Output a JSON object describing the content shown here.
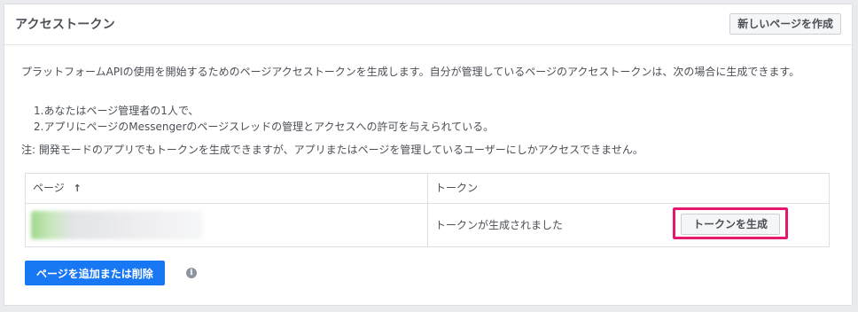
{
  "panel": {
    "title": "アクセストークン",
    "create_page_button": "新しいページを作成"
  },
  "description": "プラットフォームAPIの使用を開始するためのページアクセストークンを生成します。自分が管理しているページのアクセストークンは、次の場合に生成できます。",
  "steps": [
    "1.あなたはページ管理者の1人で、",
    "2.アプリにページのMessengerのページスレッドの管理とアクセスへの許可を与えられている。"
  ],
  "note": "注: 開発モードのアプリでもトークンを生成できますが、アプリまたはページを管理しているユーザーにしかアクセスできません。",
  "table": {
    "headers": {
      "page": "ページ",
      "token": "トークン"
    },
    "sort_icon": "arrow-up-icon",
    "rows": [
      {
        "status": "トークンが生成されました",
        "button": "トークンを生成"
      }
    ]
  },
  "footer": {
    "add_remove_button": "ページを追加または削除",
    "info_icon": "i"
  },
  "colors": {
    "primary": "#1877f2",
    "highlight": "#e5196e"
  }
}
